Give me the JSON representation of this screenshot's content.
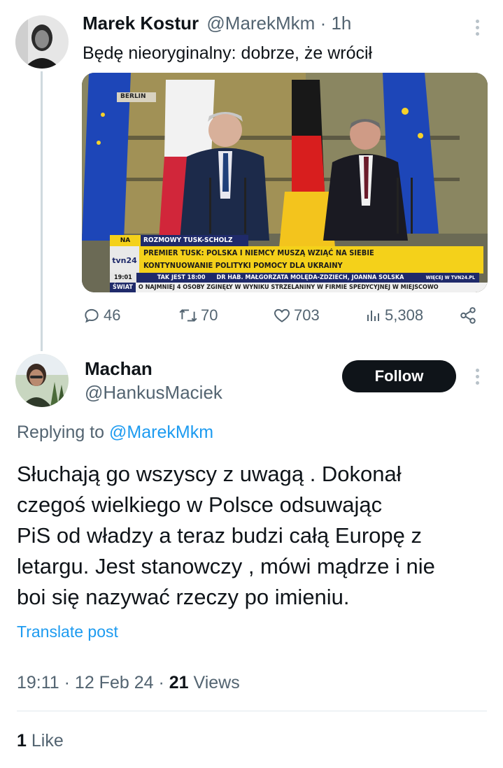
{
  "tweet1": {
    "author_name": "Marek Kostur",
    "handle": "@MarekMkm",
    "time": "· 1h",
    "text": "Będę nieoryginalny: dobrze, że wrócił",
    "media": {
      "location_tag": "BERLIN",
      "live_label": "NA ŻYWO",
      "topic": "ROZMOWY TUSK-SCHOLZ",
      "headline_line1": "PREMIER TUSK: POLSKA I NIEMCY MUSZĄ WZIĄĆ NA SIEBIE",
      "headline_line2": "KONTYNUOWANIE POLITYKI POMOCY DLA UKRAINY",
      "channel_logo": "tvn24",
      "clock": "19:01",
      "program": "TAK JEST 18:00",
      "guests": "DR HAB. MAŁGORZATA MOLĘDA-ZDZIECH, JOANNA SOLSKA",
      "website": "WIĘCEJ W TVN24.PL",
      "world_label": "ŚWIAT",
      "ticker": "O NAJMNIEJ 4 OSOBY ZGINĘŁY W WYNIKU STRZELANINY W FIRMIE SPEDYCYJNEJ W MIEJSCOWO"
    },
    "stats": {
      "replies": "46",
      "reposts": "70",
      "likes": "703",
      "views": "5,308"
    }
  },
  "tweet2": {
    "author_name": "Machan",
    "handle": "@HankusMaciek",
    "follow_label": "Follow",
    "replying_prefix": "Replying to",
    "replying_handle": "@MarekMkm",
    "text_lines": [
      "Słuchają go wszyscy z uwagą . Dokonał",
      "czegoś wielkiego w Polsce odsuwając",
      "PiS od władzy a teraz budzi całą Europę z",
      "letargu. Jest stanowczy , mówi mądrze i nie",
      "boi się nazywać rzeczy po imieniu."
    ],
    "translate_label": "Translate post",
    "timestamp": "19:11 · 12 Feb 24 ·",
    "views_count": "21",
    "views_label": "Views",
    "likes_count": "1",
    "likes_label": "Like"
  },
  "icons": {
    "reply": "reply-icon",
    "repost": "repost-icon",
    "like": "heart-icon",
    "views": "views-icon",
    "share": "share-icon",
    "more": "more-dots-icon"
  },
  "colors": {
    "accent": "#1d9bf0",
    "text": "#0f1419",
    "secondary": "#536471",
    "follow_bg": "#0f1419",
    "ticker_yellow": "#f4d11a"
  }
}
